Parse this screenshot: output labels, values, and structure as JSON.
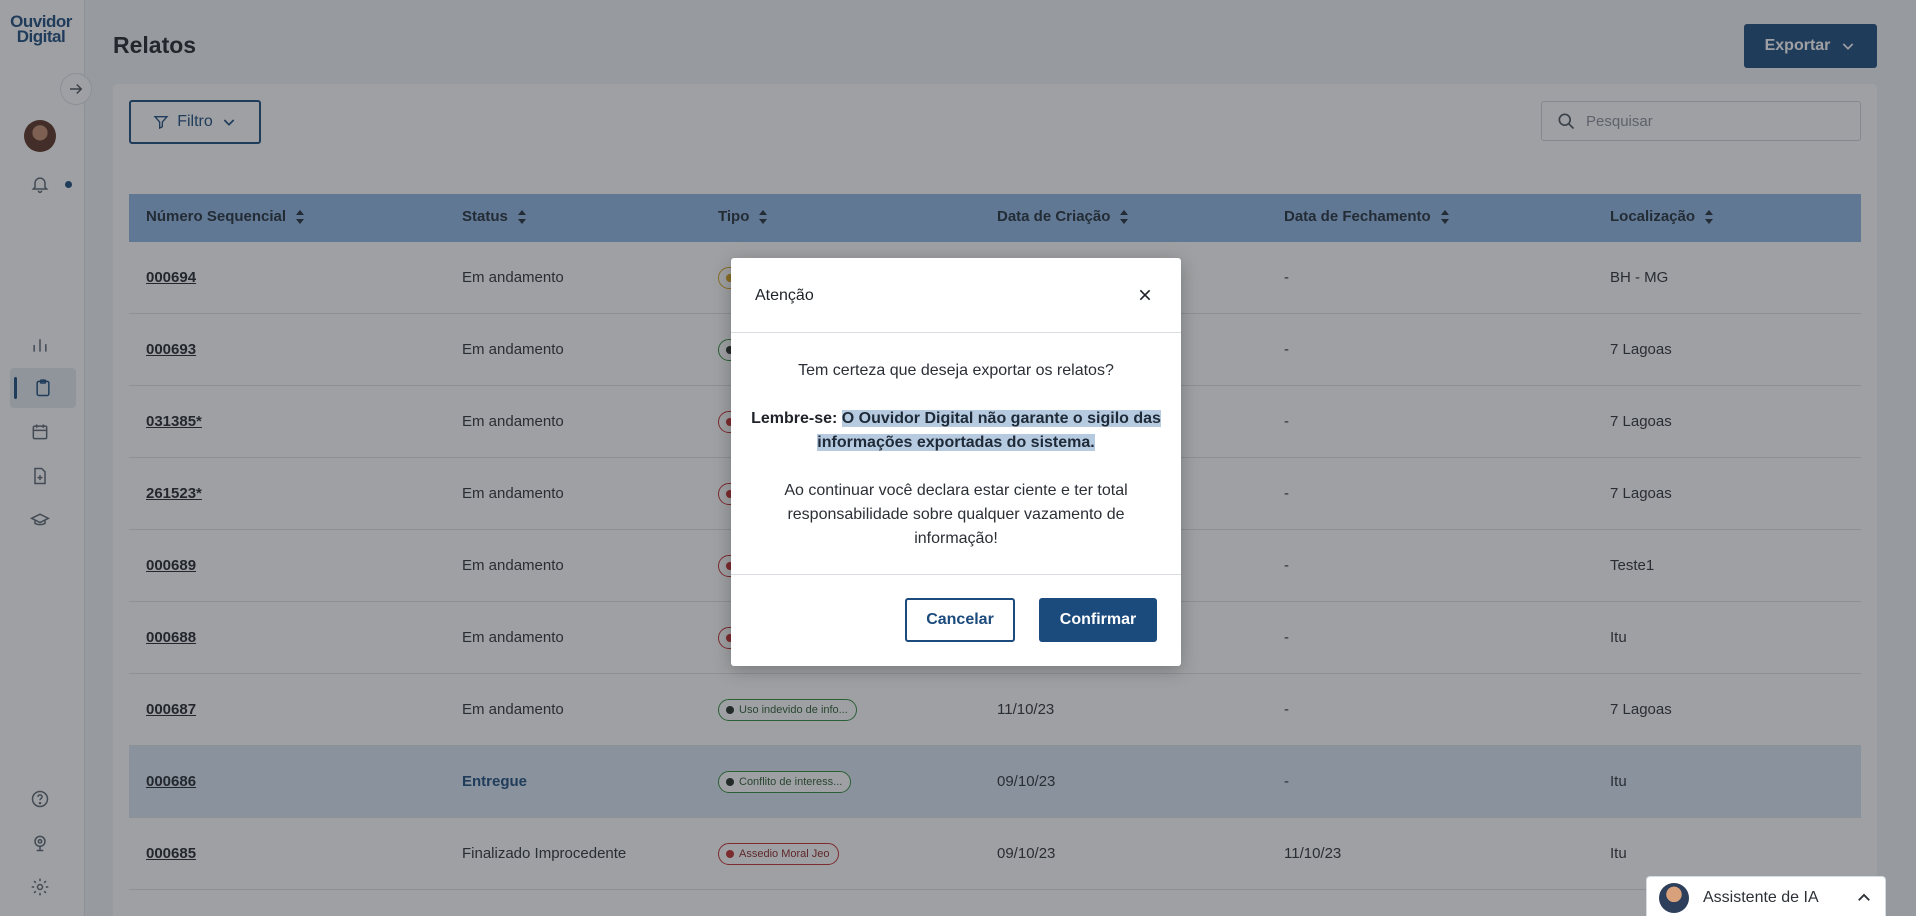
{
  "app": {
    "logo_line1": "Ouvidor",
    "logo_line2": "Digital"
  },
  "page": {
    "title": "Relatos"
  },
  "toolbar": {
    "export_label": "Exportar",
    "filter_label": "Filtro",
    "search_placeholder": "Pesquisar"
  },
  "table": {
    "headers": [
      "Número Sequencial",
      "Status",
      "Tipo",
      "Data de Criação",
      "Data de Fechamento",
      "Localização"
    ],
    "rows": [
      {
        "seq": "000694",
        "status": "Em andamento",
        "tipo": "",
        "tipo_color": "yellow",
        "criacao": "",
        "fechamento": "-",
        "local": "BH - MG"
      },
      {
        "seq": "000693",
        "status": "Em andamento",
        "tipo": "",
        "tipo_color": "green",
        "criacao": "",
        "fechamento": "-",
        "local": "7 Lagoas"
      },
      {
        "seq": "031385*",
        "status": "Em andamento",
        "tipo": "",
        "tipo_color": "red",
        "criacao": "",
        "fechamento": "-",
        "local": "7 Lagoas"
      },
      {
        "seq": "261523*",
        "status": "Em andamento",
        "tipo": "",
        "tipo_color": "red",
        "criacao": "",
        "fechamento": "-",
        "local": "7 Lagoas"
      },
      {
        "seq": "000689",
        "status": "Em andamento",
        "tipo": "",
        "tipo_color": "red",
        "criacao": "",
        "fechamento": "-",
        "local": "Teste1"
      },
      {
        "seq": "000688",
        "status": "Em andamento",
        "tipo": "",
        "tipo_color": "red",
        "criacao": "",
        "fechamento": "-",
        "local": "Itu"
      },
      {
        "seq": "000687",
        "status": "Em andamento",
        "tipo": "Uso indevido de info...",
        "tipo_color": "green",
        "criacao": "11/10/23",
        "fechamento": "-",
        "local": "7 Lagoas"
      },
      {
        "seq": "000686",
        "status": "Entregue",
        "tipo": "Conflito de interess...",
        "tipo_color": "green",
        "criacao": "09/10/23",
        "fechamento": "-",
        "local": "Itu"
      },
      {
        "seq": "000685",
        "status": "Finalizado Improcedente",
        "tipo": "Assedio Moral Jeo",
        "tipo_color": "red",
        "criacao": "09/10/23",
        "fechamento": "11/10/23",
        "local": "Itu"
      }
    ]
  },
  "modal": {
    "title": "Atenção",
    "question": "Tem certeza que deseja exportar os relatos?",
    "remind_label": "Lembre-se:",
    "remind_text": "O Ouvidor Digital não garante o sigilo das informações exportadas do sistema.",
    "declaration": "Ao continuar você declara estar ciente e ter total responsabilidade sobre qualquer vazamento de informação!",
    "cancel_label": "Cancelar",
    "confirm_label": "Confirmar"
  },
  "assistant": {
    "label": "Assistente de IA"
  },
  "colors": {
    "primary": "#1b4a7c",
    "header_bg": "#8eb6e2",
    "highlight_row": "#dbe7f5",
    "badge_red": "#c22a2a",
    "badge_green": "#2f8a3a",
    "badge_yellow": "#d8a31a"
  },
  "icons": [
    "arrow-right-icon",
    "bell-icon",
    "bar-chart-icon",
    "clipboard-icon",
    "calendar-icon",
    "file-plus-icon",
    "graduation-cap-icon",
    "help-circle-icon",
    "webcam-icon",
    "gear-icon",
    "filter-icon",
    "search-icon",
    "chevron-down-icon",
    "close-icon",
    "chevron-up-icon"
  ]
}
